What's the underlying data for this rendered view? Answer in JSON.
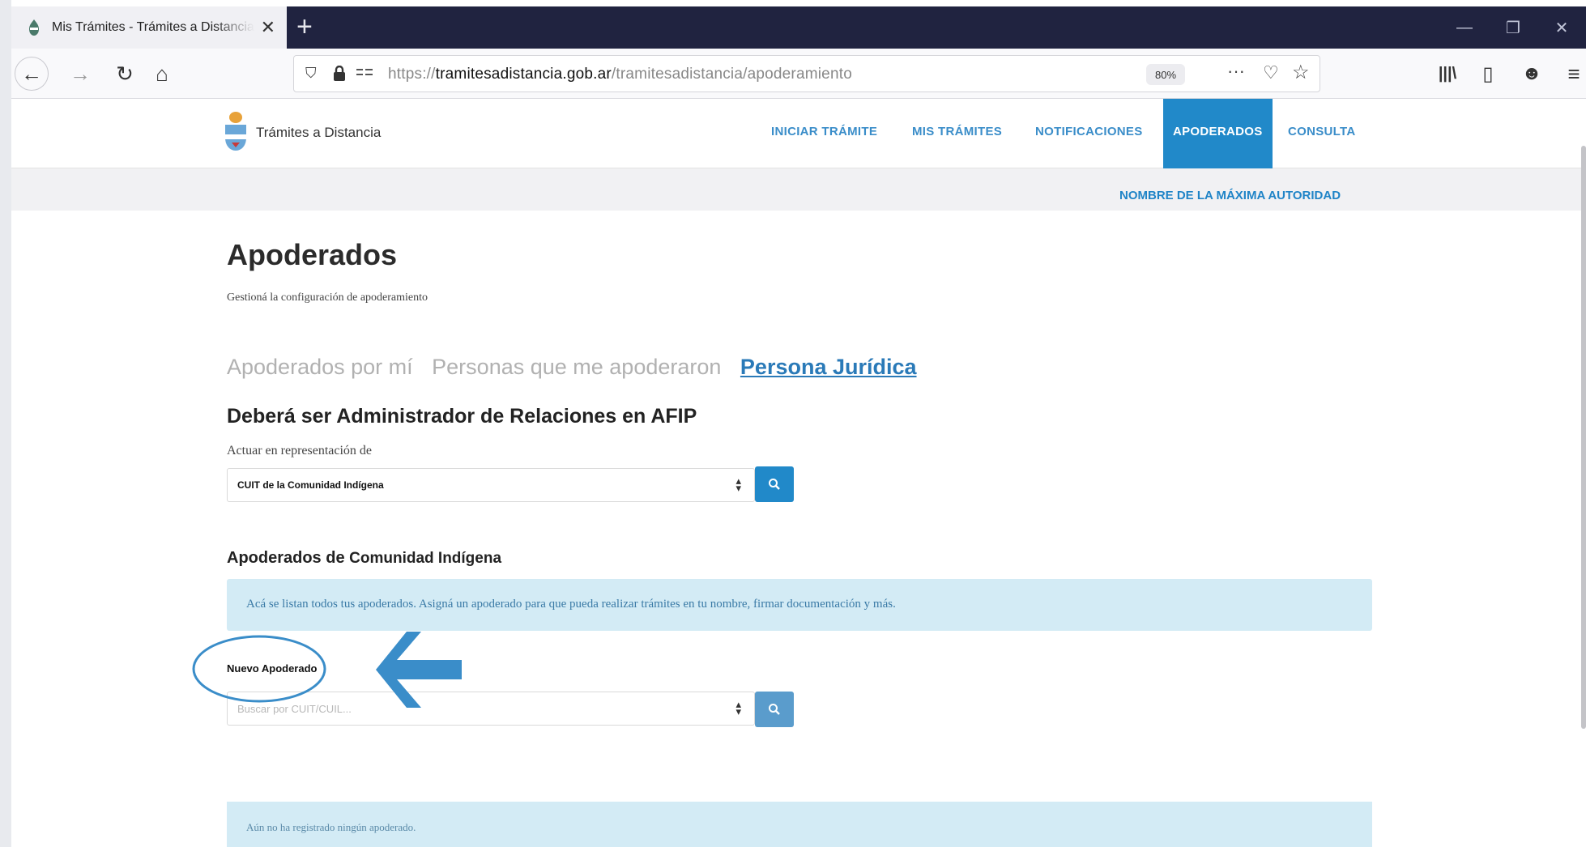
{
  "browser": {
    "tab_title": "Mis Trámites - Trámites a Distancia",
    "tab_close": "✕",
    "new_tab": "+",
    "window_controls": {
      "minimize": "—",
      "restore": "❐",
      "close": "✕"
    },
    "nav": {
      "back": "←",
      "forward": "→",
      "reload": "↻",
      "home": "⌂"
    },
    "url_prefix": "https://",
    "url_domain": "tramitesadistancia.gob.ar",
    "url_path": "/tramitesadistancia/apoderamiento",
    "zoom": "80%",
    "url_icons": {
      "shield": "⛉",
      "lock": "🔒",
      "more": "···",
      "pocket": "♡",
      "star": "☆"
    },
    "toolbar_icons": {
      "library": "|||\\",
      "sidebar": "▯",
      "account": "☻",
      "menu": "≡"
    }
  },
  "site": {
    "brand": "Trámites a Distancia",
    "menu": [
      {
        "label": "INICIAR TRÁMITE"
      },
      {
        "label": "MIS TRÁMITES"
      },
      {
        "label": "NOTIFICACIONES"
      },
      {
        "label": "APODERADOS",
        "active": true
      },
      {
        "label": "CONSULTA"
      }
    ],
    "user_name": "NOMBRE DE LA MÁXIMA AUTORIDAD"
  },
  "page": {
    "title": "Apoderados",
    "subtitle": "Gestioná la configuración de apoderamiento",
    "tabs": [
      {
        "label": "Apoderados por mí"
      },
      {
        "label": "Personas que me apoderaron"
      },
      {
        "label": "Persona Jurídica",
        "active": true
      }
    ],
    "section_title": "Deberá ser Administrador de Relaciones en AFIP",
    "representation_label": "Actuar en representación de",
    "representation_value": "CUIT de la Comunidad Indígena",
    "apoderados_prefix": "Apoderados de",
    "apoderados_entity": "Comunidad Indígena",
    "info_text": "Acá se listan todos tus apoderados. Asigná un apoderado para que pueda realizar trámites en tu nombre, firmar documentación y más.",
    "new_label": "Nuevo Apoderado",
    "search_placeholder": "Buscar por CUIT/CUIL...",
    "empty_text": "Aún no ha registrado ningún apoderado."
  },
  "colors": {
    "accent": "#2189c9",
    "annotation": "#3a8dc9",
    "info_bg": "#d3ebf5"
  }
}
